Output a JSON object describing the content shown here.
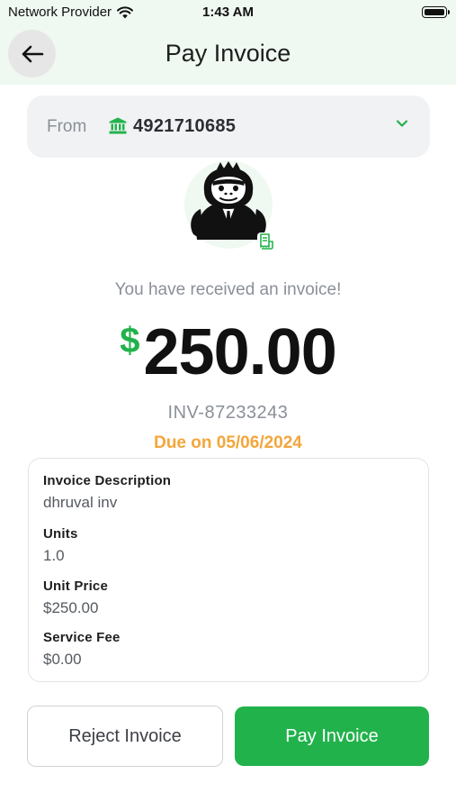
{
  "status_bar": {
    "carrier": "Network Provider",
    "time": "1:43 AM",
    "icons": [
      "wifi-icon",
      "battery-icon"
    ]
  },
  "header": {
    "title": "Pay Invoice",
    "back_icon": "arrow-left-icon"
  },
  "from_account": {
    "label": "From",
    "account_number": "4921710685",
    "icon": "bank-icon",
    "dropdown_icon": "chevron-down-icon"
  },
  "avatar": {
    "icon": "gorilla-avatar",
    "badge_icon": "invoice-receipt-icon"
  },
  "invoice": {
    "message": "You have received an invoice!",
    "currency_symbol": "$",
    "amount": "250.00",
    "id": "INV-87233243",
    "due": "Due on 05/06/2024"
  },
  "details": [
    {
      "label": "Invoice Description",
      "value": "dhruval inv"
    },
    {
      "label": "Units",
      "value": "1.0"
    },
    {
      "label": "Unit Price",
      "value": "$250.00"
    },
    {
      "label": "Service Fee",
      "value": "$0.00"
    }
  ],
  "actions": {
    "reject_label": "Reject Invoice",
    "pay_label": "Pay Invoice"
  },
  "colors": {
    "accent_green": "#22b24c",
    "due_orange": "#f3a63b",
    "header_bg": "#eff9f1",
    "card_bg": "#f1f2f4"
  }
}
